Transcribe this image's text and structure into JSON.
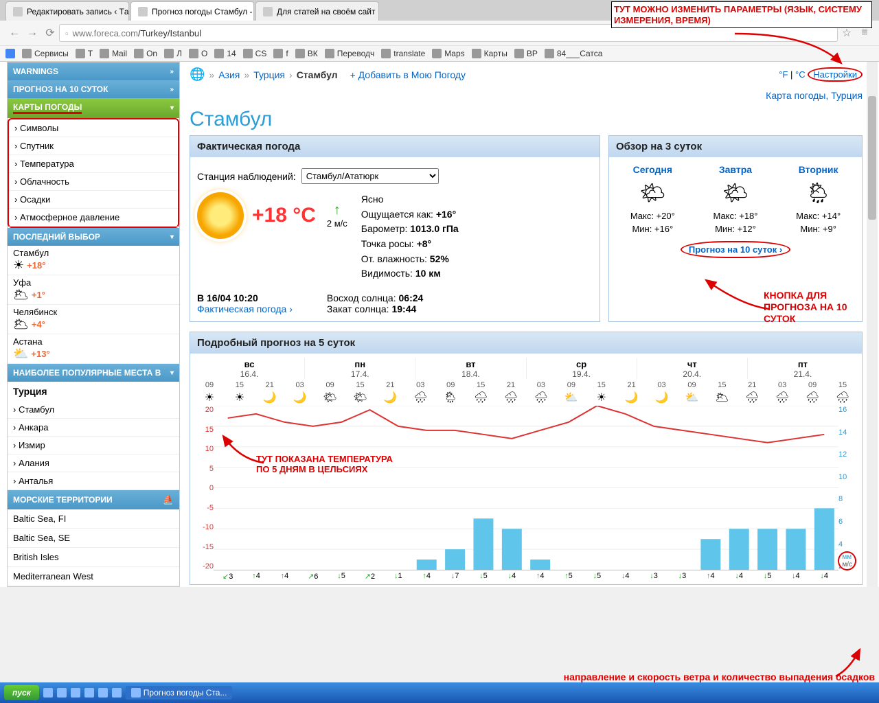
{
  "browser": {
    "tabs": [
      {
        "title": "Редактировать запись ‹ Тa"
      },
      {
        "title": "Прогноз погоды Стамбул -",
        "active": true
      },
      {
        "title": "Для статей на своём сайт"
      }
    ],
    "url_host": "www.foreca.com",
    "url_path": "/Turkey/Istanbul",
    "bookmarks": [
      "Сервисы",
      "T",
      "Mail",
      "On",
      "Л",
      "O",
      "14",
      "CS",
      "f",
      "ВК",
      "Переводч",
      "translate",
      "Maps",
      "Карты",
      "BP",
      "84___Сатса"
    ]
  },
  "annotations": {
    "top": "ТУТ МОЖНО ИЗМЕНИТЬ ПАРАМЕТРЫ (ЯЗЫК, СИСТЕМУ ИЗМЕРЕНИЯ, ВРЕМЯ)",
    "button10": "КНОПКА ДЛЯ ПРОГНОЗА НА 10 СУТОК",
    "chart_temp_l1": "ТУТ ПОКАЗАНА ТЕМПЕРАТУРА",
    "chart_temp_l2": "ПО 5 ДНЯМ В ЦЕЛЬСИЯХ",
    "bottom": "направление и скорость ветра и количество выпадения осадков"
  },
  "sidebar": {
    "warnings": "WARNINGS",
    "forecast10": "ПРОГНОЗ НА 10 СУТОК",
    "weather_maps": "КАРТЫ ПОГОДЫ",
    "map_items": [
      "Символы",
      "Спутник",
      "Температура",
      "Облачность",
      "Осадки",
      "Атмосферное давление"
    ],
    "recent": "ПОСЛЕДНИЙ ВЫБОР",
    "recent_items": [
      {
        "city": "Стамбул",
        "temp": "+18°",
        "icon": "☀"
      },
      {
        "city": "Уфа",
        "temp": "+1°",
        "icon": "🌥"
      },
      {
        "city": "Челябинск",
        "temp": "+4°",
        "icon": "🌥"
      },
      {
        "city": "Астана",
        "temp": "+13°",
        "icon": "⛅"
      }
    ],
    "popular": "НАИБОЛЕЕ ПОПУЛЯРНЫЕ МЕСТА В",
    "pop_country": "Турция",
    "pop_items": [
      "Стамбул",
      "Анкара",
      "Измир",
      "Алания",
      "Анталья"
    ],
    "seas": "МОРСКИЕ ТЕРРИТОРИИ",
    "sea_items": [
      "Baltic Sea, FI",
      "Baltic Sea, SE",
      "British Isles",
      "Mediterranean West"
    ]
  },
  "crumbs": {
    "asia": "Азия",
    "turkey": "Турция",
    "city": "Стамбул",
    "add": "+ Добавить в Мою Погоду"
  },
  "settings": {
    "f": "°F",
    "c": "°C",
    "label": "Настройки"
  },
  "map_link": "Карта погоды, Турция",
  "city_h1": "Стамбул",
  "current": {
    "panel_title": "Фактическая погода",
    "station_label": "Станция наблюдений:",
    "station_value": "Стамбул/Ататюрк",
    "temp": "+18 °C",
    "wind": "2 м/с",
    "cond": "Ясно",
    "feels_lbl": "Ощущается как:",
    "feels": "+16°",
    "baro_lbl": "Барометр:",
    "baro": "1013.0 гПа",
    "dew_lbl": "Точка росы:",
    "dew": "+8°",
    "hum_lbl": "От. влажность:",
    "hum": "52%",
    "vis_lbl": "Видимость:",
    "vis": "10 км",
    "obs_time": "В 16/04 10:20",
    "obs_link": "Фактическая погода ›",
    "sunrise_lbl": "Восход солнца:",
    "sunrise": "06:24",
    "sunset_lbl": "Закат солнца:",
    "sunset": "19:44"
  },
  "overview": {
    "panel_title": "Обзор на 3 суток",
    "days": [
      {
        "name": "Сегодня",
        "max": "Макс: +20°",
        "min": "Мин: +16°",
        "icon": "🌤"
      },
      {
        "name": "Завтра",
        "max": "Макс: +18°",
        "min": "Мин: +12°",
        "icon": "🌤"
      },
      {
        "name": "Вторник",
        "max": "Макс: +14°",
        "min": "Мин: +9°",
        "icon": "🌦"
      }
    ],
    "link": "Прогноз на 10 суток ›"
  },
  "forecast5": {
    "panel_title": "Подробный прогноз на 5 суток",
    "days": [
      {
        "name": "вс",
        "date": "16.4."
      },
      {
        "name": "пн",
        "date": "17.4."
      },
      {
        "name": "вт",
        "date": "18.4."
      },
      {
        "name": "ср",
        "date": "19.4."
      },
      {
        "name": "чт",
        "date": "20.4."
      },
      {
        "name": "пт",
        "date": "21.4."
      }
    ],
    "hours": [
      "09",
      "15",
      "21",
      "03",
      "09",
      "15",
      "21",
      "03",
      "09",
      "15",
      "21",
      "03",
      "09",
      "15",
      "21",
      "03",
      "09",
      "15",
      "21",
      "03",
      "09",
      "15"
    ],
    "icons": [
      "☀",
      "☀",
      "🌙",
      "🌙",
      "🌤",
      "🌤",
      "🌙",
      "🌧",
      "🌦",
      "🌧",
      "🌧",
      "🌧",
      "⛅",
      "☀",
      "🌙",
      "🌙",
      "⛅",
      "🌥",
      "🌧",
      "🌧",
      "🌧",
      "🌧"
    ],
    "mm_label": "мм",
    "ms_label": "м/с"
  },
  "chart_data": {
    "type": "combo",
    "x_hours": [
      "09",
      "15",
      "21",
      "03",
      "09",
      "15",
      "21",
      "03",
      "09",
      "15",
      "21",
      "03",
      "09",
      "15",
      "21",
      "03",
      "09",
      "15",
      "21",
      "03",
      "09",
      "15"
    ],
    "series": [
      {
        "name": "Temperature °C",
        "type": "line",
        "axis": "left",
        "values": [
          17,
          18,
          16,
          15,
          16,
          19,
          15,
          14,
          14,
          13,
          12,
          14,
          16,
          20,
          18,
          15,
          14,
          13,
          12,
          11,
          12,
          13
        ]
      },
      {
        "name": "Precipitation mm",
        "type": "bar",
        "axis": "right",
        "values": [
          0,
          0,
          0,
          0,
          0,
          0,
          0,
          1,
          2,
          5,
          4,
          1,
          0,
          0,
          0,
          0,
          0,
          3,
          4,
          4,
          4,
          6
        ]
      }
    ],
    "wind": [
      {
        "dir": "↙",
        "spd": 3
      },
      {
        "dir": "↑",
        "spd": 4
      },
      {
        "dir": "↑",
        "spd": 4
      },
      {
        "dir": "↗",
        "spd": 6
      },
      {
        "dir": "↓",
        "spd": 5
      },
      {
        "dir": "↗",
        "spd": 2
      },
      {
        "dir": "↓",
        "spd": 1
      },
      {
        "dir": "↑",
        "spd": 4
      },
      {
        "dir": "↓",
        "spd": 7
      },
      {
        "dir": "↓",
        "spd": 5
      },
      {
        "dir": "↓",
        "spd": 4
      },
      {
        "dir": "↑",
        "spd": 4
      },
      {
        "dir": "↑",
        "spd": 5
      },
      {
        "dir": "↓",
        "spd": 5
      },
      {
        "dir": "↓",
        "spd": 4
      },
      {
        "dir": "↓",
        "spd": 3
      },
      {
        "dir": "↓",
        "spd": 3
      },
      {
        "dir": "↑",
        "spd": 4
      },
      {
        "dir": "↓",
        "spd": 4
      },
      {
        "dir": "↓",
        "spd": 5
      },
      {
        "dir": "↓",
        "spd": 4
      },
      {
        "dir": "↓",
        "spd": 4
      }
    ],
    "y_left": {
      "label": "°C",
      "ticks": [
        20,
        15,
        10,
        5,
        0,
        -5,
        -10,
        -15,
        -20
      ]
    },
    "y_right": {
      "label": "мм",
      "ticks": [
        16,
        14,
        12,
        10,
        8,
        6,
        4,
        2
      ]
    }
  },
  "taskbar": {
    "start": "пуск",
    "window": "Прогноз погоды Ста..."
  }
}
